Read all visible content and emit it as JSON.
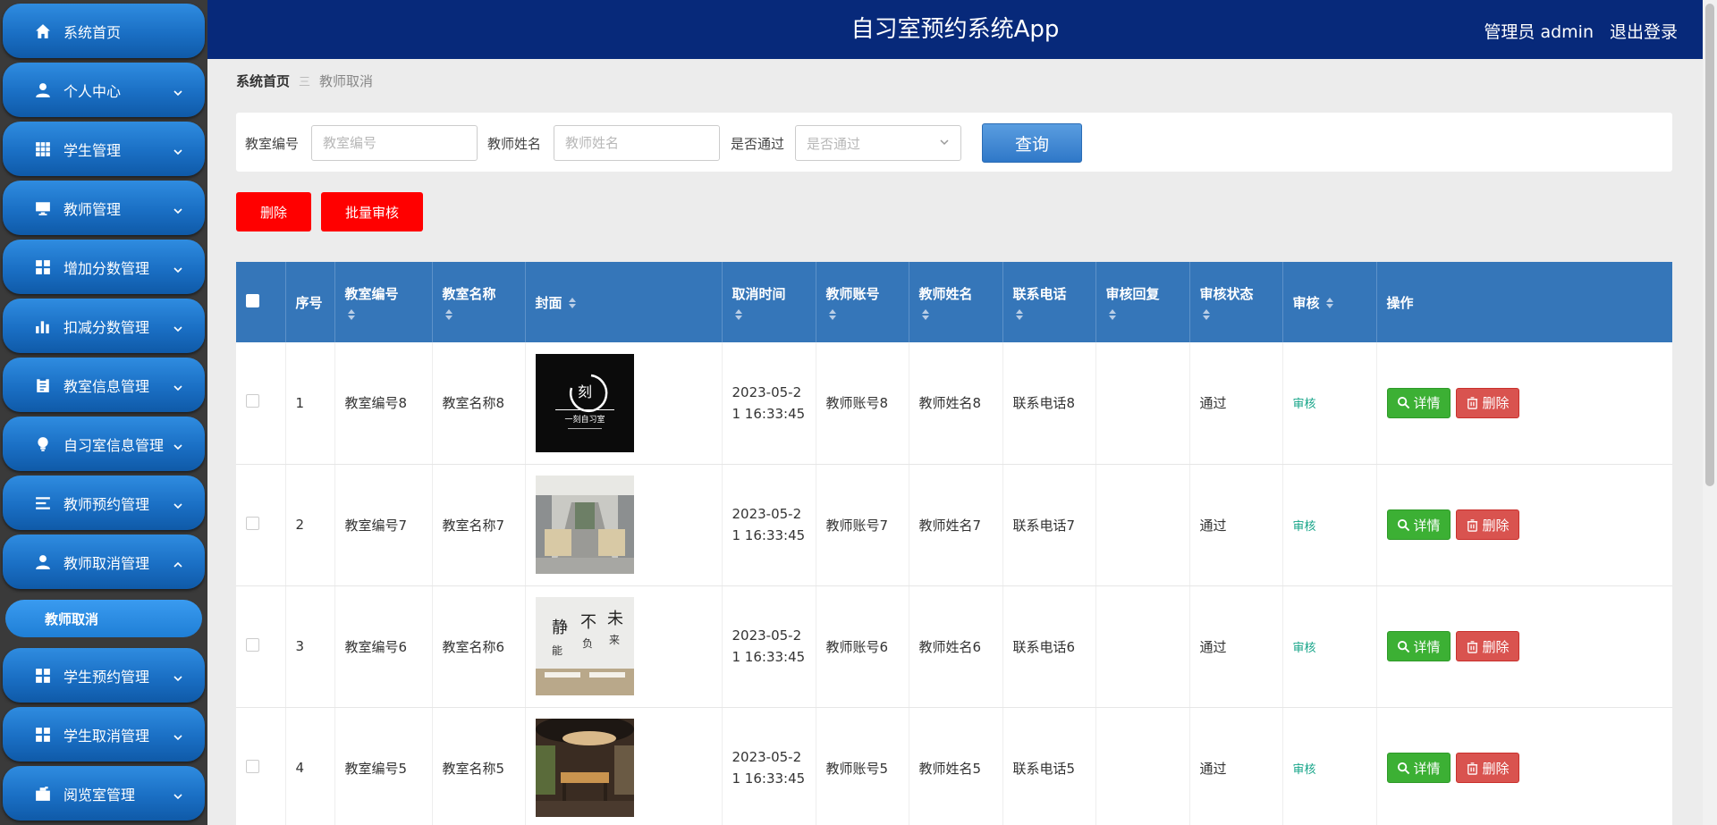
{
  "header": {
    "title": "自习室预约系统App",
    "user": "管理员 admin",
    "logout": "退出登录"
  },
  "sidebar": {
    "items": [
      {
        "label": "系统首页",
        "icon": "home-icon"
      },
      {
        "label": "个人中心",
        "icon": "user-icon"
      },
      {
        "label": "学生管理",
        "icon": "grid-icon"
      },
      {
        "label": "教师管理",
        "icon": "monitor-icon"
      },
      {
        "label": "增加分数管理",
        "icon": "apps-icon"
      },
      {
        "label": "扣减分数管理",
        "icon": "bar-chart-icon"
      },
      {
        "label": "教室信息管理",
        "icon": "clipboard-icon"
      },
      {
        "label": "自习室信息管理",
        "icon": "bulb-icon"
      },
      {
        "label": "教师预约管理",
        "icon": "list-icon"
      },
      {
        "label": "教师取消管理",
        "icon": "user-icon"
      },
      {
        "label": "学生预约管理",
        "icon": "apps-icon"
      },
      {
        "label": "学生取消管理",
        "icon": "apps-icon"
      },
      {
        "label": "阅览室管理",
        "icon": "briefcase-icon"
      }
    ],
    "sub_item": "教师取消"
  },
  "breadcrumb": {
    "home": "系统首页",
    "sep": "三",
    "current": "教师取消"
  },
  "search": {
    "classroom_no_label": "教室编号",
    "classroom_no_placeholder": "教室编号",
    "teacher_name_label": "教师姓名",
    "teacher_name_placeholder": "教师姓名",
    "passed_label": "是否通过",
    "passed_placeholder": "是否通过",
    "query": "查询"
  },
  "actions": {
    "delete": "删除",
    "batch_audit": "批量审核"
  },
  "table": {
    "headers": [
      "序号",
      "教室编号",
      "教室名称",
      "封面",
      "取消时间",
      "教师账号",
      "教师姓名",
      "联系电话",
      "审核回复",
      "审核状态",
      "审核",
      "操作"
    ],
    "rows": [
      {
        "no": "1",
        "classroom_no": "教室编号8",
        "classroom_name": "教室名称8",
        "time_a": "2023-05-2",
        "time_b": "1 16:33:45",
        "account": "教师账号8",
        "name": "教师姓名8",
        "phone": "联系电话8",
        "reply": "",
        "status": "通过",
        "audit": "审核",
        "detail": "详情",
        "del": "删除"
      },
      {
        "no": "2",
        "classroom_no": "教室编号7",
        "classroom_name": "教室名称7",
        "time_a": "2023-05-2",
        "time_b": "1 16:33:45",
        "account": "教师账号7",
        "name": "教师姓名7",
        "phone": "联系电话7",
        "reply": "",
        "status": "通过",
        "audit": "审核",
        "detail": "详情",
        "del": "删除"
      },
      {
        "no": "3",
        "classroom_no": "教室编号6",
        "classroom_name": "教室名称6",
        "time_a": "2023-05-2",
        "time_b": "1 16:33:45",
        "account": "教师账号6",
        "name": "教师姓名6",
        "phone": "联系电话6",
        "reply": "",
        "status": "通过",
        "audit": "审核",
        "detail": "详情",
        "del": "删除"
      },
      {
        "no": "4",
        "classroom_no": "教室编号5",
        "classroom_name": "教室名称5",
        "time_a": "2023-05-2",
        "time_b": "1 16:33:45",
        "account": "教师账号5",
        "name": "教师姓名5",
        "phone": "联系电话5",
        "reply": "",
        "status": "通过",
        "audit": "审核",
        "detail": "详情",
        "del": "删除"
      }
    ]
  },
  "colors": {
    "header_bg": "#07297a",
    "menu_blue": "#1a6fc4",
    "table_head": "#3576b9",
    "danger": "#ff0000",
    "success": "#3cb034"
  }
}
